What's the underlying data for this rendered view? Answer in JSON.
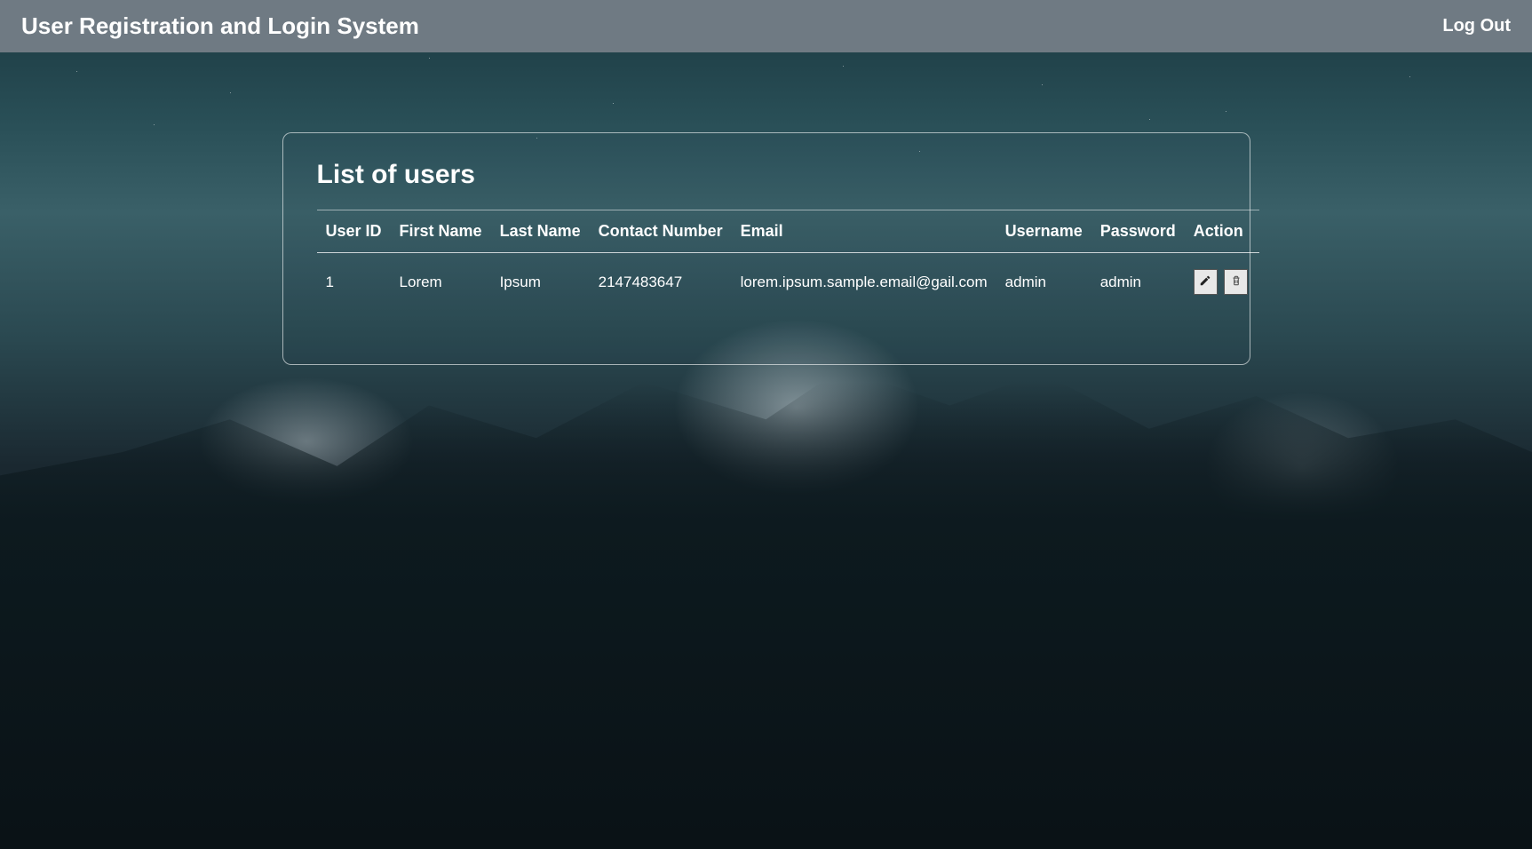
{
  "navbar": {
    "title": "User Registration and Login System",
    "logout_label": "Log Out"
  },
  "panel": {
    "title": "List of users"
  },
  "table": {
    "headers": {
      "user_id": "User ID",
      "first_name": "First Name",
      "last_name": "Last Name",
      "contact_number": "Contact Number",
      "email": "Email",
      "username": "Username",
      "password": "Password",
      "action": "Action"
    },
    "rows": [
      {
        "user_id": "1",
        "first_name": "Lorem",
        "last_name": "Ipsum",
        "contact_number": "2147483647",
        "email": "lorem.ipsum.sample.email@gail.com",
        "username": "admin",
        "password": "admin"
      }
    ]
  }
}
